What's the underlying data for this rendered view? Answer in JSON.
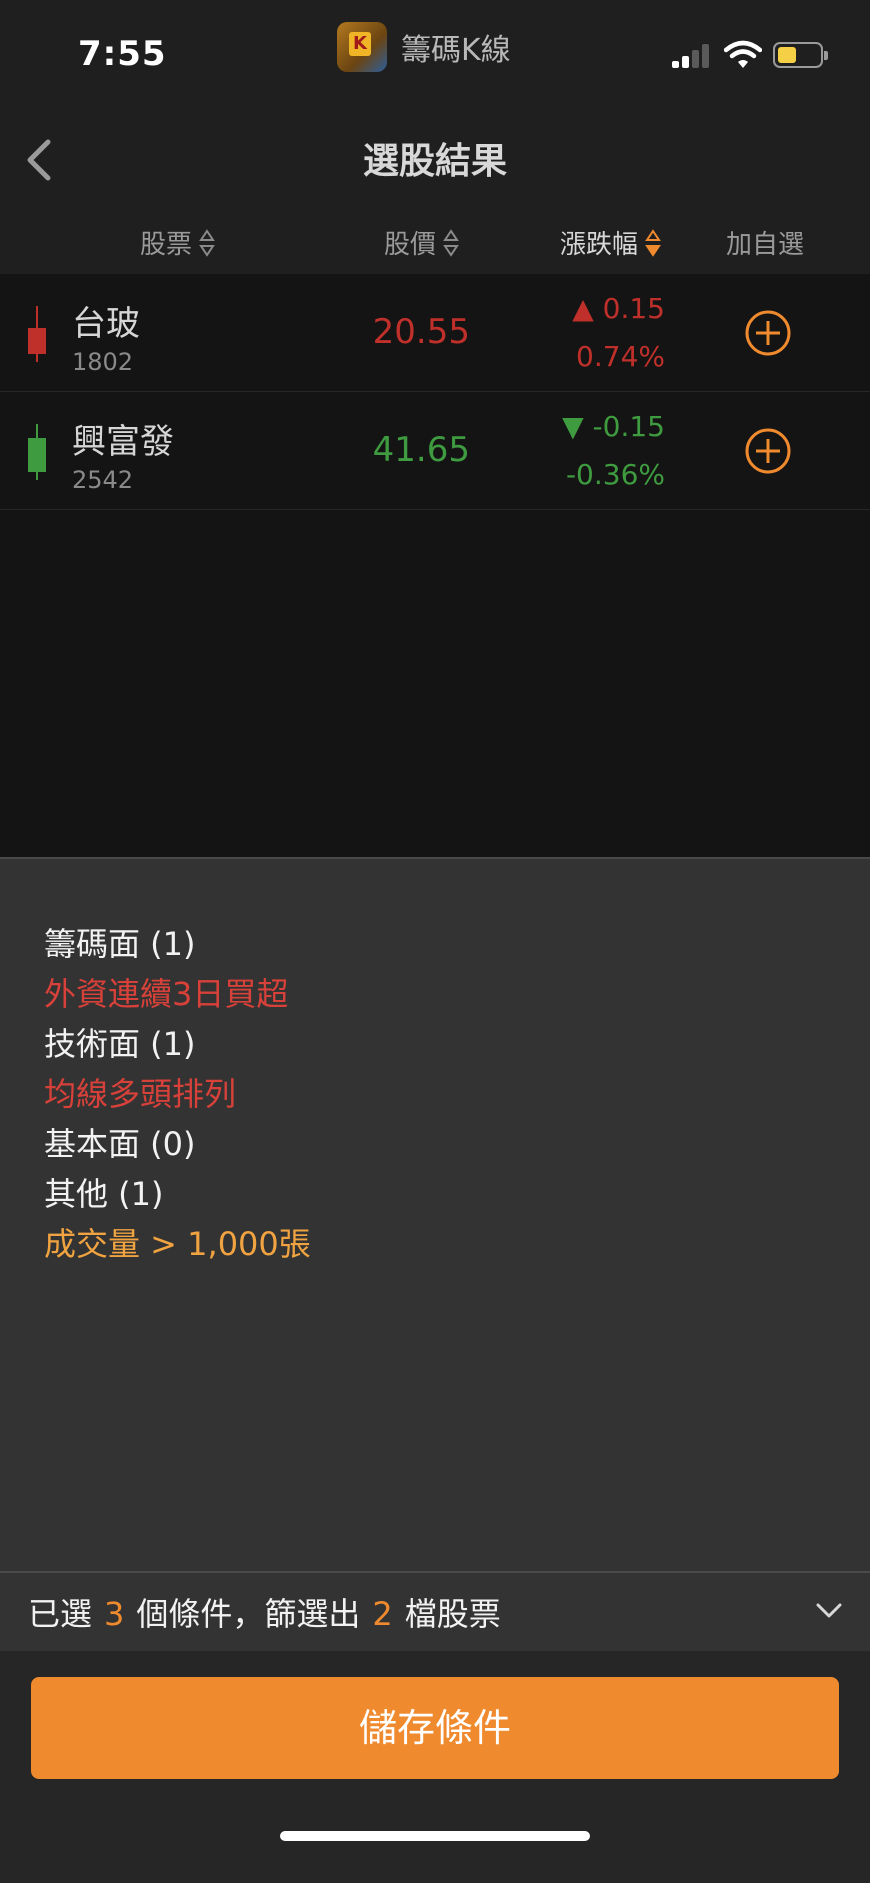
{
  "status": {
    "time": "7:55",
    "app_name": "籌碼K線"
  },
  "nav": {
    "title": "選股結果"
  },
  "columns": {
    "stock": "股票",
    "price": "股價",
    "change": "漲跌幅",
    "add": "加自選"
  },
  "rows": [
    {
      "name": "台玻",
      "code": "1802",
      "price": "20.55",
      "change": "▲ 0.15",
      "percent": "0.74%",
      "direction": "up",
      "color": "#c0302b"
    },
    {
      "name": "興富發",
      "code": "2542",
      "price": "41.65",
      "change": "▼ -0.15",
      "percent": "-0.36%",
      "direction": "down",
      "color": "#3f9b3f"
    }
  ],
  "conditions": [
    {
      "category": "籌碼面 (1)",
      "items": [
        {
          "text": "外資連續3日買超",
          "color": "red"
        }
      ]
    },
    {
      "category": "技術面 (1)",
      "items": [
        {
          "text": "均線多頭排列",
          "color": "red"
        }
      ]
    },
    {
      "category": "基本面 (0)",
      "items": []
    },
    {
      "category": "其他 (1)",
      "items": [
        {
          "text": "成交量 > 1,000張",
          "color": "orange"
        }
      ]
    }
  ],
  "summary": {
    "prefix": "已選",
    "selected_count": "3",
    "middle": "個條件，篩選出",
    "result_count": "2",
    "suffix": "檔股票"
  },
  "save_label": "儲存條件",
  "colors": {
    "accent": "#f08a2e",
    "up": "#c0302b",
    "down": "#3f9b3f"
  }
}
